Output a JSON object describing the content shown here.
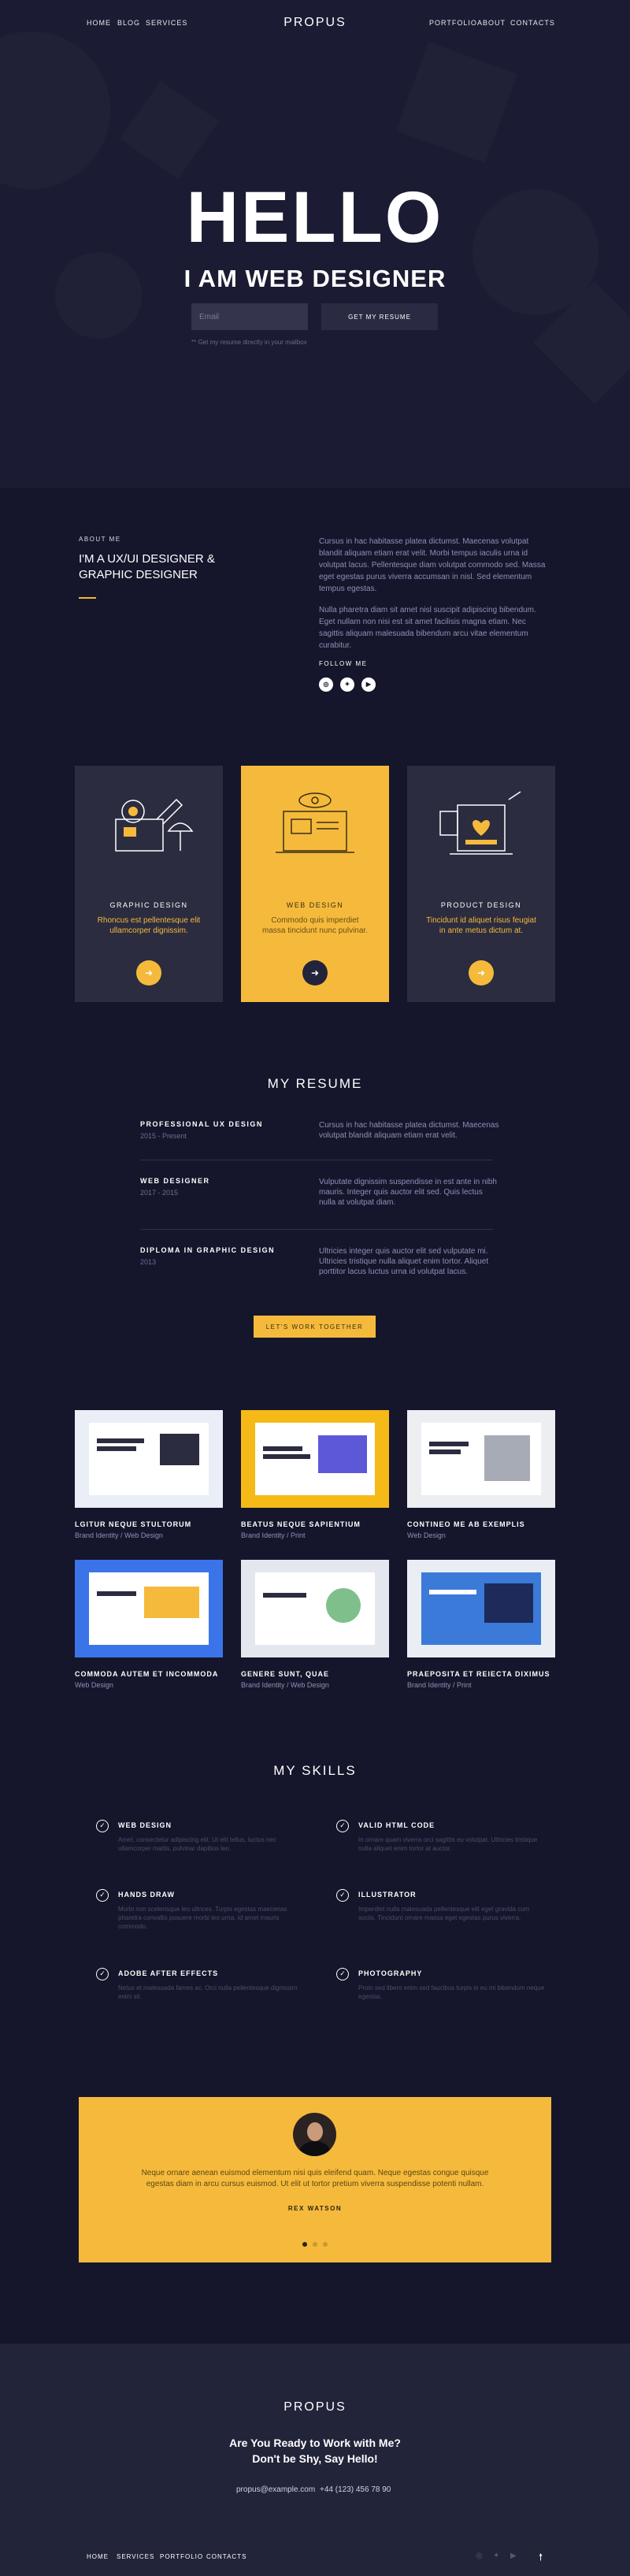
{
  "nav": {
    "left": [
      "HOME",
      "BLOG",
      "SERVICES"
    ],
    "right": [
      "PORTFOLIO",
      "ABOUT",
      "CONTACTS"
    ],
    "logo": "PROPUS"
  },
  "hero": {
    "title": "HELLO",
    "subtitle": "I AM WEB DESIGNER",
    "email_placeholder": "Email",
    "button": "GET MY RESUME",
    "note": "** Get my resume directly in your mailbox"
  },
  "about": {
    "label": "ABOUT ME",
    "title": "I'M A UX/UI DESIGNER & GRAPHIC DESIGNER",
    "p1": "Cursus in hac habitasse platea dictumst. Maecenas volutpat blandit aliquam etiam erat velit. Morbi tempus iaculis urna id volutpat lacus. Pellentesque diam volutpat commodo sed. Massa eget egestas purus viverra accumsan in nisl. Sed elementum tempus egestas.",
    "p2": "Nulla pharetra diam sit amet nisl suscipit adipiscing bibendum. Eget nullam non nisi est sit amet facilisis magna etiam. Nec sagittis aliquam malesuada bibendum arcu vitae elementum curabitur.",
    "follow": "FOLLOW ME",
    "social_icons": [
      "instagram-icon",
      "twitter-icon",
      "youtube-icon"
    ]
  },
  "services": [
    {
      "title": "GRAPHIC DESIGN",
      "text": "Rhoncus est pellentesque elit ullamcorper dignissim.",
      "highlight": false
    },
    {
      "title": "WEB DESIGN",
      "text": "Commodo quis imperdiet massa tincidunt nunc pulvinar.",
      "highlight": true
    },
    {
      "title": "PRODUCT DESIGN",
      "text": "Tincidunt id aliquet risus feugiat in ante metus dictum at.",
      "highlight": false
    }
  ],
  "resume": {
    "title": "MY RESUME",
    "items": [
      {
        "title": "PROFESSIONAL UX DESIGN",
        "date": "2015 - Present",
        "desc": "Cursus in hac habitasse platea dictumst. Maecenas volutpat blandit aliquam etiam erat velit."
      },
      {
        "title": "WEB DESIGNER",
        "date": "2017 - 2015",
        "desc": "Vulputate dignissim suspendisse in est ante in nibh mauris. Integer quis auctor elit sed. Quis lectus nulla at volutpat diam."
      },
      {
        "title": "DIPLOMA IN GRAPHIC DESIGN",
        "date": "2013",
        "desc": "Ultricies integer quis auctor elit sed vulputate mi. Ultricies tristique nulla aliquet enim tortor. Aliquet porttitor lacus luctus urna id volutpat lacus."
      }
    ],
    "button": "LET'S WORK TOGETHER"
  },
  "portfolio": [
    {
      "title": "LGITUR NEQUE STULTORUM",
      "category": "Brand Identity / Web Design",
      "bg": "#e9eef7"
    },
    {
      "title": "BEATUS NEQUE SAPIENTIUM",
      "category": "Brand Identity / Print",
      "bg": "#f5b918"
    },
    {
      "title": "CONTINEO ME AB EXEMPLIS",
      "category": "Web Design",
      "bg": "#eceef2"
    },
    {
      "title": "COMMODA AUTEM ET INCOMMODA",
      "category": "Web Design",
      "bg": "#3a74e8"
    },
    {
      "title": "GENERE SUNT, QUAE",
      "category": "Brand Identity / Web Design",
      "bg": "#e4e8ee"
    },
    {
      "title": "PRAEPOSITA ET REIECTA DIXIMUS",
      "category": "Brand Identity / Print",
      "bg": "#e9eef4"
    }
  ],
  "skills": {
    "title": "MY SKILLS",
    "items": [
      {
        "title": "WEB DESIGN",
        "desc": "Amet, consectetur adipiscing elit. Ut elit tellus, luctus nec ullamcorper mattis, pulvinar dapibus leo."
      },
      {
        "title": "VALID HTML CODE",
        "desc": "In ornare quam viverra orci sagittis eu volutpat. Ultricies tristique nulla aliquet enim tortor at auctor."
      },
      {
        "title": "HANDS DRAW",
        "desc": "Morbi non scelerisque leo ultrices. Turpis egestas maecenas pharetra convallis posuere morbi leo urna. Id amet mauris commodo."
      },
      {
        "title": "ILLUSTRATOR",
        "desc": "Imperdiet nulla malesuada pellentesque elit eget gravida cum sociis. Tincidunt ornare massa eget egestas purus viverra."
      },
      {
        "title": "ADOBE AFTER EFFECTS",
        "desc": "Netus et malesuada fames ac. Orci nulla pellentesque dignissim enim sit."
      },
      {
        "title": "PHOTOGRAPHY",
        "desc": "Proin sed libero enim sed faucibus turpis in eu mi bibendum neque egestas."
      }
    ]
  },
  "testimonial": {
    "text": "Neque ornare aenean euismod elementum nisi quis eleifend quam. Neque egestas congue quisque egestas diam in arcu cursus euismod. Ut elit ut tortor pretium viverra suspendisse potenti nullam.",
    "name": "REX WATSON",
    "dots": 3,
    "active": 0
  },
  "footer": {
    "logo": "PROPUS",
    "line1": "Are You Ready to Work with Me?",
    "line2": "Don't be Shy, Say Hello!",
    "email": "propus@example.com",
    "phone": "+44 (123) 456 78 90",
    "nav": [
      "HOME",
      "SERVICES",
      "PORTFOLIO",
      "CONTACTS"
    ],
    "social_icons": [
      "instagram-icon",
      "twitter-icon",
      "youtube-icon"
    ],
    "top_icon": "arrow-up-icon"
  },
  "colors": {
    "accent": "#f5ba3c",
    "bg": "#15162b",
    "card": "#2b2c40",
    "footer": "#22243a"
  }
}
